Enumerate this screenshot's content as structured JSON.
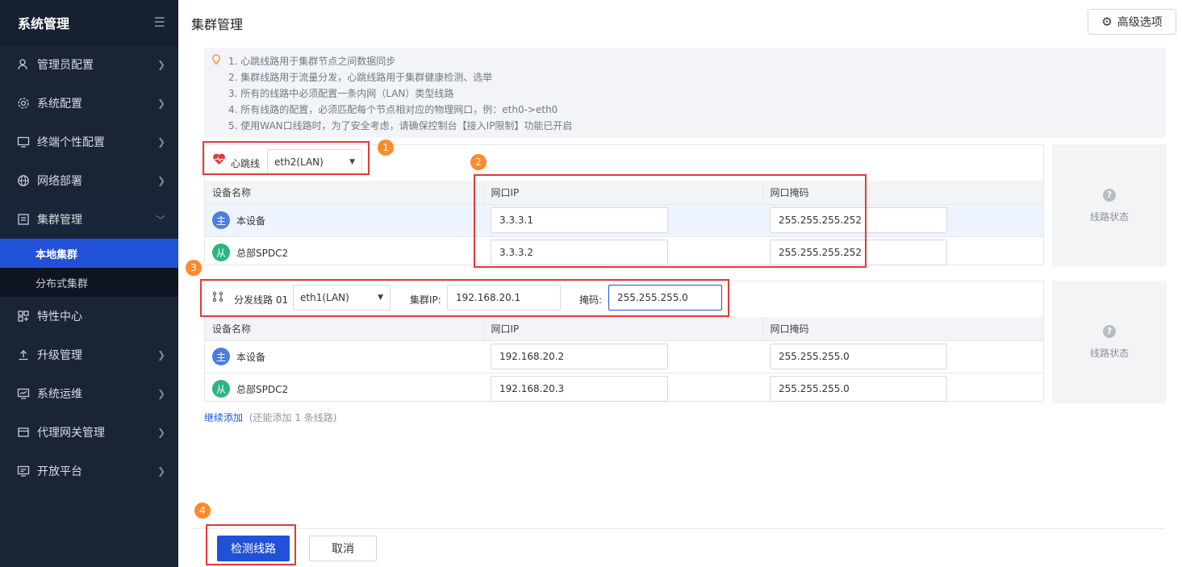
{
  "sidebar": {
    "title": "系统管理",
    "collapse_icon": "menu-collapse-icon",
    "items": [
      {
        "label": "管理员配置",
        "icon": "admin-user-icon"
      },
      {
        "label": "系统配置",
        "icon": "gear-icon"
      },
      {
        "label": "终端个性配置",
        "icon": "monitor-icon"
      },
      {
        "label": "网络部署",
        "icon": "globe-icon"
      },
      {
        "label": "集群管理",
        "icon": "cluster-icon",
        "expanded": true
      },
      {
        "label": "特性中心",
        "icon": "grid-icon"
      },
      {
        "label": "升级管理",
        "icon": "upload-icon"
      },
      {
        "label": "系统运维",
        "icon": "chart-monitor-icon"
      },
      {
        "label": "代理网关管理",
        "icon": "gateway-icon"
      },
      {
        "label": "开放平台",
        "icon": "platform-icon"
      }
    ],
    "subitems": [
      {
        "label": "本地集群",
        "active": true
      },
      {
        "label": "分布式集群",
        "active": false
      }
    ]
  },
  "header": {
    "title": "集群管理",
    "advanced_button": "高级选项"
  },
  "tips": [
    "1. 心跳线路用于集群节点之间数据同步",
    "2. 集群线路用于流量分发，心跳线路用于集群健康检测、选举",
    "3. 所有的线路中必须配置一条内网（LAN）类型线路",
    "4. 所有线路的配置，必须匹配每个节点相对应的物理网口，例：eth0->eth0",
    "5. 使用WAN口线路时，为了安全考虑，请确保控制台【接入IP限制】功能已开启"
  ],
  "heartbeat": {
    "label": "心跳线",
    "interface": "eth2(LAN)",
    "columns": [
      "设备名称",
      "网口IP",
      "网口掩码"
    ],
    "rows": [
      {
        "avatar": "主",
        "name": "本设备",
        "ip": "3.3.3.1",
        "mask": "255.255.255.252"
      },
      {
        "avatar": "从",
        "name": "总部SPDC2",
        "ip": "3.3.3.2",
        "mask": "255.255.255.252"
      }
    ],
    "status": "线路状态"
  },
  "distribution": {
    "label": "分发线路 01",
    "interface": "eth1(LAN)",
    "cluster_ip_label": "集群IP:",
    "cluster_ip": "192.168.20.1",
    "mask_label": "掩码:",
    "mask": "255.255.255.0",
    "columns": [
      "设备名称",
      "网口IP",
      "网口掩码"
    ],
    "rows": [
      {
        "avatar": "主",
        "name": "本设备",
        "ip": "192.168.20.2",
        "mask": "255.255.255.0"
      },
      {
        "avatar": "从",
        "name": "总部SPDC2",
        "ip": "192.168.20.3",
        "mask": "255.255.255.0"
      }
    ],
    "status": "线路状态"
  },
  "add_more": {
    "link": "继续添加",
    "hint": "(还能添加 1 条线路)"
  },
  "footer": {
    "check_button": "检测线路",
    "cancel_button": "取消"
  },
  "annotations": [
    "1",
    "2",
    "3",
    "4"
  ],
  "colors": {
    "sidebar_bg": "#1b2434",
    "accent": "#2151d6",
    "highlight_border": "#e53935",
    "badge": "#ff8a2a"
  }
}
